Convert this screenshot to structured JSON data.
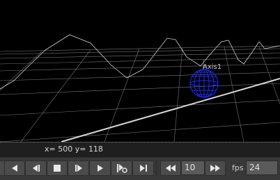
{
  "viewport": {
    "axis_label": "Axis1",
    "colors": {
      "background": "#000000",
      "grid": "#8c8c8c",
      "terrain_line": "#cfcfcf",
      "sphere": "#1a2cff"
    }
  },
  "status": {
    "coordinates": "x= 500 y= 118"
  },
  "transport": {
    "buttons": [
      {
        "name": "go-to-start-button",
        "icon": "skip-to-start-icon"
      },
      {
        "name": "play-backward-button",
        "icon": "play-backward-icon"
      },
      {
        "name": "step-backward-button",
        "icon": "step-backward-icon"
      },
      {
        "name": "stop-button",
        "icon": "stop-icon"
      },
      {
        "name": "step-forward-button",
        "icon": "step-forward-icon"
      },
      {
        "name": "play-forward-button",
        "icon": "play-forward-icon"
      },
      {
        "name": "next-keyframe-button",
        "icon": "keyframe-icon"
      },
      {
        "name": "go-to-end-button",
        "icon": "skip-to-end-icon"
      },
      {
        "name": "rewind-increment-button",
        "icon": "rewind-icon"
      },
      {
        "name": "forward-increment-button",
        "icon": "fast-forward-icon"
      }
    ],
    "increment_value": "10",
    "fps_label": "fps",
    "fps_value": "24"
  }
}
